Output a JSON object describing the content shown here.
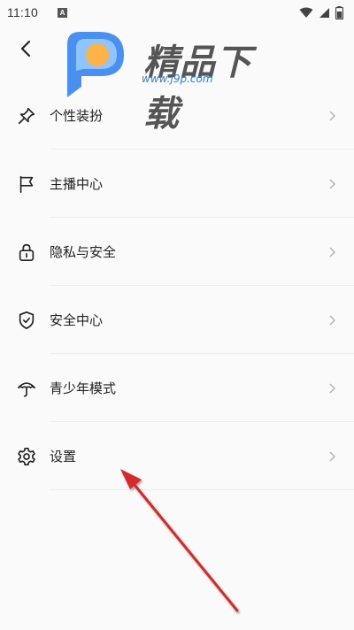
{
  "status_bar": {
    "time": "11:10",
    "notification_badge": "A",
    "icons": [
      "wifi-icon",
      "signal-icon",
      "battery-icon"
    ]
  },
  "header": {
    "back_icon": "chevron-left-icon"
  },
  "watermark": {
    "title": "精品下载",
    "url": "www.j9p.com"
  },
  "menu": {
    "items": [
      {
        "label": "个性装扮",
        "icon": "pin-icon"
      },
      {
        "label": "主播中心",
        "icon": "flag-icon"
      },
      {
        "label": "隐私与安全",
        "icon": "lock-icon"
      },
      {
        "label": "安全中心",
        "icon": "shield-check-icon"
      },
      {
        "label": "青少年模式",
        "icon": "umbrella-icon"
      },
      {
        "label": "设置",
        "icon": "gear-icon"
      }
    ]
  },
  "colors": {
    "background": "#fafafa",
    "annotation_arrow": "#d42a2a",
    "watermark_blue": "#2f7fe6",
    "watermark_orange": "#ffb347"
  }
}
